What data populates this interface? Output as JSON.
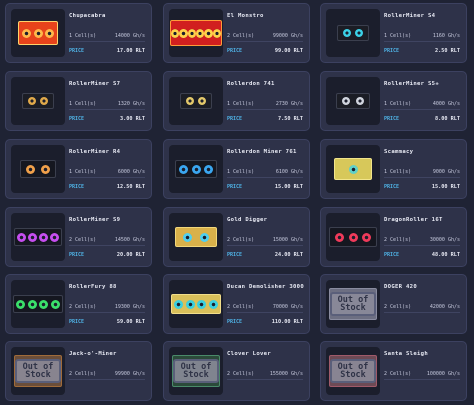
{
  "price_label": "PRICE",
  "out_of_stock_label": [
    "Out of",
    "Stock"
  ],
  "miners": [
    {
      "name": "Chupacabra",
      "cells": "1 Cell(s)",
      "power": "14000 Gh/s",
      "price": "17.00 RLT",
      "icon": "chupacabra-miner-icon",
      "out_of_stock": false
    },
    {
      "name": "El Monstro",
      "cells": "2 Cell(s)",
      "power": "99000 Gh/s",
      "price": "99.00 RLT",
      "icon": "el-monstro-miner-icon",
      "out_of_stock": false
    },
    {
      "name": "RollerMiner S4",
      "cells": "1 Cell(s)",
      "power": "1160 Gh/s",
      "price": "2.50 RLT",
      "icon": "rollerminer-s4-icon",
      "out_of_stock": false
    },
    {
      "name": "RollerMiner S7",
      "cells": "1 Cell(s)",
      "power": "1320 Gh/s",
      "price": "3.00 RLT",
      "icon": "rollerminer-s7-icon",
      "out_of_stock": false
    },
    {
      "name": "Rollerdon 741",
      "cells": "1 Cell(s)",
      "power": "2730 Gh/s",
      "price": "7.50 RLT",
      "icon": "rollerdon-741-icon",
      "out_of_stock": false
    },
    {
      "name": "RollerMiner S5+",
      "cells": "1 Cell(s)",
      "power": "4000 Gh/s",
      "price": "8.00 RLT",
      "icon": "rollerminer-s5plus-icon",
      "out_of_stock": false
    },
    {
      "name": "RollerMiner R4",
      "cells": "1 Cell(s)",
      "power": "6000 Gh/s",
      "price": "12.50 RLT",
      "icon": "rollerminer-r4-icon",
      "out_of_stock": false
    },
    {
      "name": "Rollerdon Miner 761",
      "cells": "1 Cell(s)",
      "power": "6100 Gh/s",
      "price": "15.00 RLT",
      "icon": "rollerdon-miner-761-icon",
      "out_of_stock": false
    },
    {
      "name": "Scammacy",
      "cells": "1 Cell(s)",
      "power": "9000 Gh/s",
      "price": "15.00 RLT",
      "icon": "scammacy-icon",
      "out_of_stock": false
    },
    {
      "name": "RollerMiner S9",
      "cells": "2 Cell(s)",
      "power": "14500 Gh/s",
      "price": "20.00 RLT",
      "icon": "rollerminer-s9-icon",
      "out_of_stock": false
    },
    {
      "name": "Gold Digger",
      "cells": "2 Cell(s)",
      "power": "15000 Gh/s",
      "price": "24.00 RLT",
      "icon": "gold-digger-icon",
      "out_of_stock": false
    },
    {
      "name": "DragonRoller 16T",
      "cells": "2 Cell(s)",
      "power": "30000 Gh/s",
      "price": "48.00 RLT",
      "icon": "dragonroller-16t-icon",
      "out_of_stock": false
    },
    {
      "name": "RollerFury 88",
      "cells": "2 Cell(s)",
      "power": "19300 Gh/s",
      "price": "59.00 RLT",
      "icon": "rollerfury-88-icon",
      "out_of_stock": false
    },
    {
      "name": "Ducan Demolisher 3000",
      "cells": "2 Cell(s)",
      "power": "70000 Gh/s",
      "price": "110.00 RLT",
      "icon": "ducan-demolisher-icon",
      "out_of_stock": false
    },
    {
      "name": "DOGER 420",
      "cells": "2 Cell(s)",
      "power": "42000 Gh/s",
      "price": "",
      "icon": "doger-420-icon",
      "out_of_stock": true
    },
    {
      "name": "Jack-o'-Miner",
      "cells": "2 Cell(s)",
      "power": "99900 Gh/s",
      "price": "",
      "icon": "jack-o-miner-icon",
      "out_of_stock": true
    },
    {
      "name": "Clover Lover",
      "cells": "2 Cell(s)",
      "power": "155000 Gh/s",
      "price": "",
      "icon": "clover-lover-icon",
      "out_of_stock": true
    },
    {
      "name": "Santa Sleigh",
      "cells": "2 Cell(s)",
      "power": "100000 Gh/s",
      "price": "",
      "icon": "santa-sleigh-icon",
      "out_of_stock": true
    }
  ]
}
